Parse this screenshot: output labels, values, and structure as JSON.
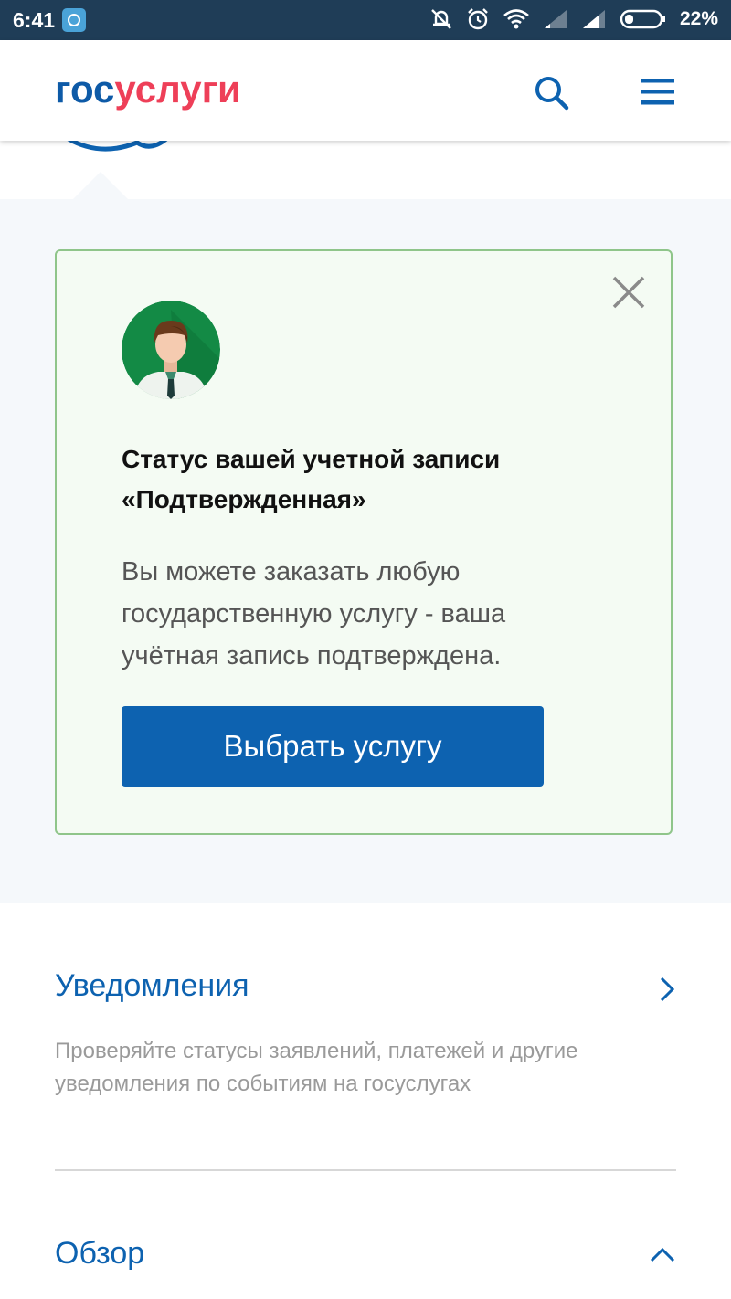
{
  "status_bar": {
    "time": "6:41",
    "battery": "22%",
    "icons": [
      "app-icon",
      "mute-icon",
      "alarm-icon",
      "wifi-icon",
      "signal-icon",
      "signal-icon",
      "battery-icon"
    ]
  },
  "header": {
    "logo_gos": "гос",
    "logo_uslugi": "услуги",
    "search_icon": "search-icon",
    "menu_icon": "menu-icon"
  },
  "status_card": {
    "title_line1": "Статус вашей учетной записи",
    "title_line2": "«Подтвержденная»",
    "text": "Вы можете заказать любую государственную услугу - ваша учётная запись подтверждена.",
    "button_label": "Выбрать услугу"
  },
  "notifications": {
    "title": "Уведомления",
    "description": "Проверяйте статусы заявлений, платежей и другие уведомления по событиям на госуслугах"
  },
  "overview": {
    "title": "Обзор"
  },
  "colors": {
    "status_bar": "#1f3d57",
    "brand_blue": "#0d62b0",
    "brand_red": "#ee3f58",
    "card_bg": "#f4fbf3",
    "card_border": "#8fc58a"
  }
}
